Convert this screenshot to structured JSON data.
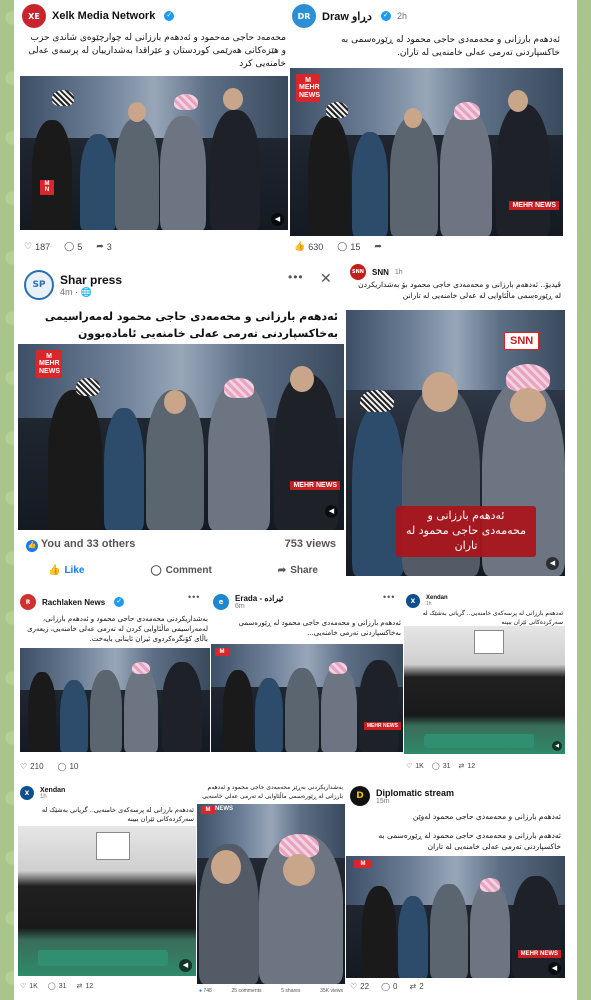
{
  "posts": {
    "xelk": {
      "name": "Xelk Media Network",
      "text": "محەمەد حاجی مەحمود و ئەدهەم بارزانی لە چوارچێوەی شاندی حزب و هێزەکانی هەرێمی کوردستان و عێراقدا بەشدارییان لە پرسەی عەلی خامنەیی کرد",
      "stats": {
        "likes": "187",
        "comments": "5",
        "shares": "3"
      },
      "badge": "MEHR NEWS"
    },
    "draw": {
      "name": "Draw دڕاو",
      "time": "2h",
      "text": "ئەدهەم بارزانی و محەمەدی حاجی محمود لە ڕێورەسمی بە خاکسپاردنی تەرمی عەلی خامنەیی لە تاران.",
      "badge": "MEHR NEWS",
      "stats": {
        "likes": "630",
        "comments": "15"
      }
    },
    "shar": {
      "name": "Shar press",
      "time": "4m",
      "text": "ئەدهەم بارزانی و محەمەدی حاجی محمود لەمەراسیمی بەخاکسپاردنی تەرمی عەلی خامنەیی ئامادەبوون",
      "badge": "MEHR NEWS",
      "reactions": "You and 33 others",
      "views": "753 views",
      "actions": {
        "like": "Like",
        "comment": "Comment",
        "share": "Share"
      }
    },
    "snn": {
      "name": "SNN",
      "time": "1h",
      "text": "ڤیدیۆ.. ئەدهەم بارزانی و محەمەدی حاجی محمود بۆ بەشداریکردن لە ڕێورەسمی ماڵئاوایی لە عەلی خامنەیی لە تارانن",
      "logo": "SNN",
      "lower_third": "ئەدهەم بارزانی و محەمەدی حاجی محمود لە تاران"
    },
    "rachlaken": {
      "name": "Rachlaken News",
      "text": "بەشداریکردنی محەمەدی حاجی محمود و ئەدهەم بارزانی، لەمەراسیمی ماڵئاوایی کردن لە تەرمی عەلی خامنەیی، زیعەری باڵای کۆنگرەکردوی ئیران ئاینانی بایەخت.",
      "stats": {
        "likes": "210",
        "comments": "10"
      }
    },
    "erada": {
      "name": "Erada - ئیرادە",
      "time": "6m",
      "text": "ئەدهەم بارزانی و محەمەدی حاجی محمود لە ڕێورەسمی بەخاکسپاردنی تەرمی خامنەیی...",
      "badge": "MEHR NEWS"
    },
    "xendan1": {
      "name": "Xendan",
      "time": "1h",
      "text": "ئەدهەم بارزانی لە پرسەکەی خامنەیی.. گریانی بەشێک لە سەرکردەکانی ئێران ببینە",
      "stats": {
        "likes": "1K",
        "comments": "31",
        "shares": "12"
      }
    },
    "xendan2": {
      "name": "Xendan",
      "time": "1h",
      "text": "ئەدهەم بارزانی لە پرسەکەی خامنەیی.. گریانی بەشێک لە سەرکردەکانی ئێران ببینە",
      "stats": {
        "likes": "1K",
        "comments": "31",
        "shares": "12"
      }
    },
    "center": {
      "text": "بەشداریکردنی بەڕێز محەمەدی حاجی محمود و ئەدهەم بارزانی لە ڕێورەسمی ماڵئاوایی لە تەرمی عەلی خامنەیی",
      "badge": "NEWS",
      "stats": {
        "likes": "748",
        "comments": "25 comments",
        "shares": "5 shares",
        "views": "35K views"
      }
    },
    "diplomatic": {
      "name": "Diplomatic stream",
      "time": "15m",
      "text": "ئەدهەم بارزانی و محەمەدی حاجی محمود لە ڕێورەسمی بە خاکسپاردنی تەرمی عەلی خامنەیی لە تاران",
      "header_text": "ئەدهەم بارزانی و محەمەدی حاجی محمود لەوێن",
      "badge": "MEHR NEWS",
      "stats": {
        "likes": "22",
        "comments": "0",
        "shares": "2"
      }
    }
  },
  "colors": {
    "accent": "#1877f2",
    "mehr_red": "#d8262b",
    "background": "#a9c58c"
  }
}
